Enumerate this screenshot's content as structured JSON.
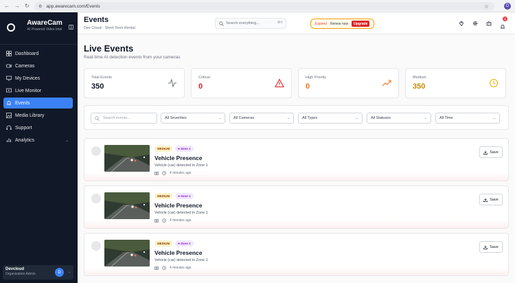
{
  "browser": {
    "url": "app.awarecam.com/Events",
    "profile_initial": "D"
  },
  "sidebar": {
    "brand_title": "AwareCam",
    "brand_subtitle": "AI Powered Video Intel",
    "items": [
      {
        "label": "Dashboard",
        "icon": "grid-icon"
      },
      {
        "label": "Cameras",
        "icon": "camera-icon"
      },
      {
        "label": "My Devices",
        "icon": "devices-icon"
      },
      {
        "label": "Live Monitor",
        "icon": "monitor-icon"
      },
      {
        "label": "Events",
        "icon": "bell-icon",
        "active": true
      },
      {
        "label": "Media Library",
        "icon": "image-icon"
      },
      {
        "label": "Support",
        "icon": "headset-icon"
      },
      {
        "label": "Analytics",
        "icon": "chart-icon"
      }
    ],
    "user": {
      "name": "Devcloud",
      "role": "Organization Admin",
      "initial": "D"
    }
  },
  "header": {
    "title": "Events",
    "subtitle": "Dev Cloud - Short Term Rental",
    "search_placeholder": "Search everything...",
    "search_shortcut": "⌘K",
    "subscription": {
      "status": "Expired",
      "renew": "Renew now",
      "upgrade": "Upgrade"
    },
    "notification_count": "1"
  },
  "main": {
    "title": "Live Events",
    "subtitle": "Real-time AI detection events from your cameras",
    "stats": [
      {
        "label": "Total Events",
        "value": "350",
        "color": "#111827",
        "icon": "activity-icon"
      },
      {
        "label": "Critical",
        "value": "0",
        "color": "#dc2626",
        "icon": "alert-triangle-icon"
      },
      {
        "label": "High Priority",
        "value": "0",
        "color": "#f97316",
        "icon": "trending-up-icon"
      },
      {
        "label": "Medium",
        "value": "350",
        "color": "#ca8a04",
        "icon": "clock-icon"
      }
    ],
    "filters": {
      "search_placeholder": "Search events...",
      "severity": "All Severities",
      "camera": "All Cameras",
      "type": "All Types",
      "status": "All Statuses",
      "time": "All Time"
    },
    "events": [
      {
        "severity": "MEDIUM",
        "zone": "Zone 1",
        "title": "Vehicle Presence",
        "description": "Vehicle (car) detected in Zone 1",
        "time": "4 minutes ago",
        "save_label": "Save"
      },
      {
        "severity": "MEDIUM",
        "zone": "Zone 1",
        "title": "Vehicle Presence",
        "description": "Vehicle (car) detected in Zone 1",
        "time": "4 minutes ago",
        "save_label": "Save"
      },
      {
        "severity": "MEDIUM",
        "zone": "Zone 1",
        "title": "Vehicle Presence",
        "description": "Vehicle (car) detected in Zone 1",
        "time": "4 minutes ago",
        "save_label": "Save"
      }
    ]
  }
}
